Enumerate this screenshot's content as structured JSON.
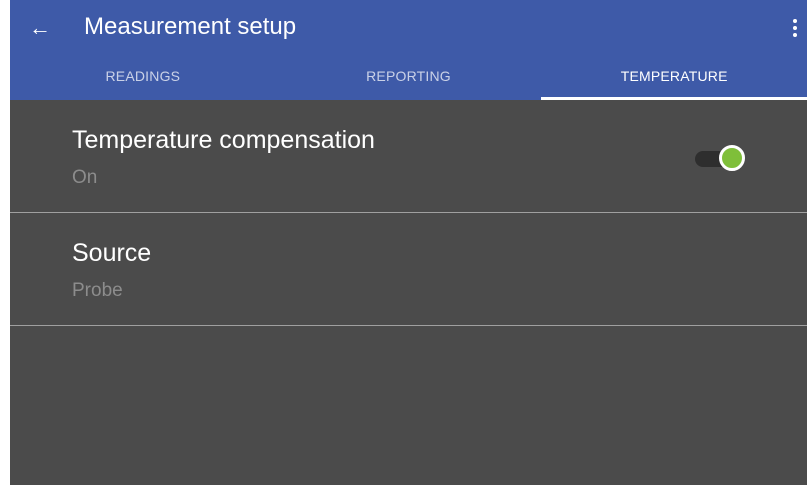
{
  "appbar": {
    "title": "Measurement setup",
    "back_icon": "arrow-left-icon",
    "overflow_icon": "more-vertical-icon",
    "color": "#3e5aa8"
  },
  "tabs": [
    {
      "label": "READINGS",
      "active": false
    },
    {
      "label": "REPORTING",
      "active": false
    },
    {
      "label": "TEMPERATURE",
      "active": true
    }
  ],
  "settings": [
    {
      "title": "Temperature compensation",
      "value": "On",
      "control": "toggle",
      "toggle_on": true,
      "toggle_color": "#7fbf3a"
    },
    {
      "title": "Source",
      "value": "Probe"
    }
  ]
}
